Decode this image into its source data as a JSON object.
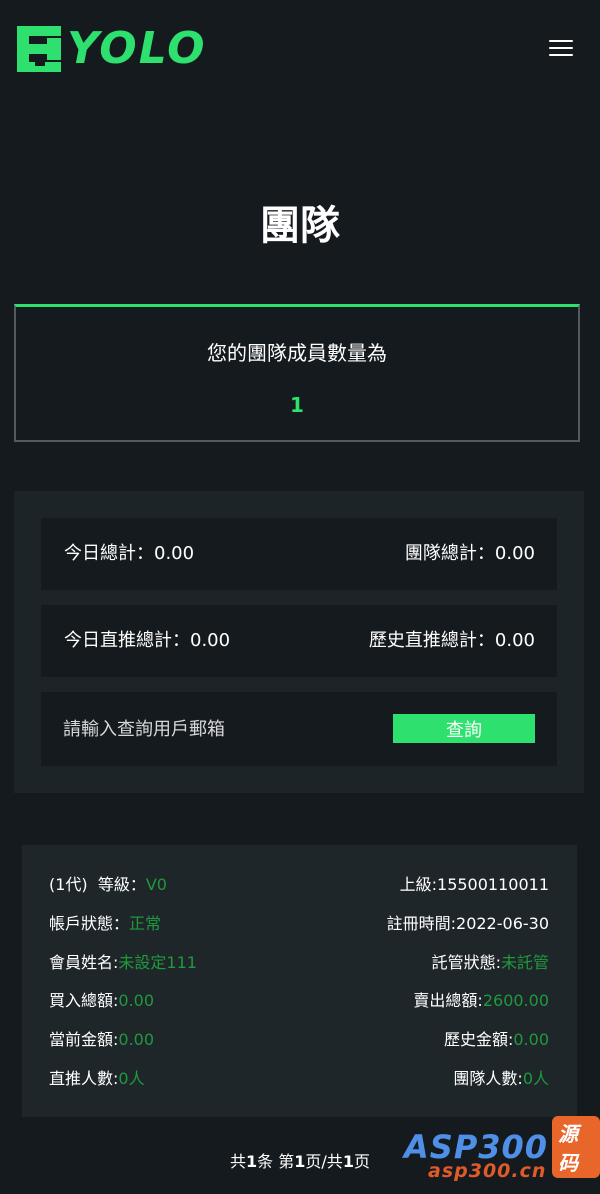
{
  "header": {
    "logo_text": "YOLO",
    "brand_color": "#2ee06e"
  },
  "page": {
    "title": "團隊"
  },
  "team": {
    "member_label": "您的團隊成員數量為",
    "member_count": "1"
  },
  "stats": {
    "today_total_label": "今日總計：",
    "today_total_value": "0.00",
    "team_total_label": "團隊總計：",
    "team_total_value": "0.00",
    "today_direct_label": "今日直推總計：",
    "today_direct_value": "0.00",
    "history_direct_label": "歷史直推總計：",
    "history_direct_value": "0.00"
  },
  "search": {
    "placeholder": "請輸入查詢用戶郵箱",
    "button_label": "查詢"
  },
  "member": {
    "generation": "(1代)",
    "level_label": "等級：",
    "level_value": "V0",
    "superior_label": "上級:",
    "superior_value": "15500110011",
    "account_status_label": "帳戶狀態：",
    "account_status_value": "正常",
    "register_time_label": "註冊時間:",
    "register_time_value": "2022-06-30",
    "name_label": "會員姓名:",
    "name_value": "未設定111",
    "custody_label": "託管狀態:",
    "custody_value": "未託管",
    "buy_total_label": "買入總額:",
    "buy_total_value": "0.00",
    "sell_total_label": "賣出總額:",
    "sell_total_value": "2600.00",
    "current_amount_label": "當前金額:",
    "current_amount_value": "0.00",
    "history_amount_label": "歷史金額:",
    "history_amount_value": "0.00",
    "direct_count_label": "直推人數:",
    "direct_count_value": "0人",
    "team_count_label": "團隊人數:",
    "team_count_value": "0人"
  },
  "pagination": {
    "p1": "共",
    "total": "1",
    "p2": "条 第",
    "page": "1",
    "p3": "页/共",
    "pages": "1",
    "p4": "页"
  },
  "watermark": {
    "brand": "ASP300",
    "tag": "源码",
    "url": "asp300.cn"
  }
}
